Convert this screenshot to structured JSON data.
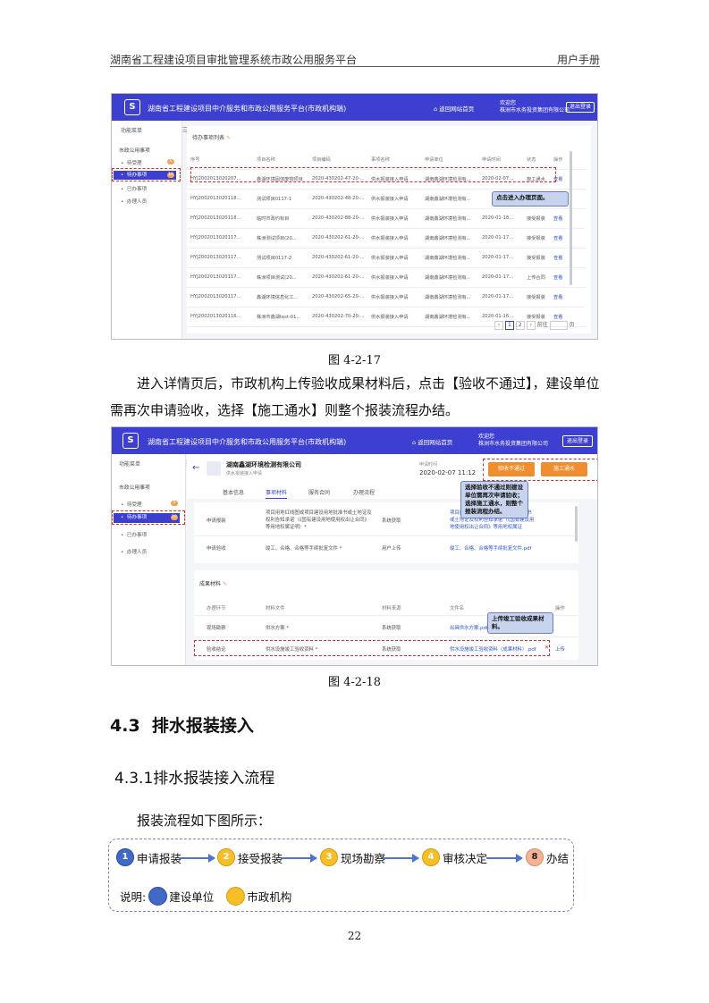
{
  "header": {
    "title": "湖南省工程建设项目审批管理系统市政公用服务平台",
    "doc_type": "用户手册"
  },
  "fig1": {
    "app_title": "湖南省工程建设项目中介服务和市政公用服务平台(市政机构端)",
    "home_link": "返回网站首页",
    "welcome_line1": "欢迎您",
    "welcome_line2": "株洲市水务投资集团有限公司",
    "logout": "退出登录",
    "menu_title": "功能菜单",
    "menu_group": "市政公用事项",
    "menu_items": [
      {
        "label": "待受理",
        "count": "5"
      },
      {
        "label": "待办事项",
        "count": "10"
      },
      {
        "label": "已办事项",
        "count": ""
      },
      {
        "label": "办理人员",
        "count": ""
      }
    ],
    "list_title": "待办事项列表",
    "columns": [
      "序号",
      "项目名称",
      "项目编码",
      "事项名称",
      "申请单位",
      "申请时间",
      "状态",
      "操作"
    ],
    "rows": [
      [
        "HYJ2002013020207...",
        "鑫湖环境固体废物项目",
        "2020-430202-47-20-...",
        "供水报装接入申请",
        "湖南鑫湖环境检测有...",
        "2020-02-07...",
        "施工通水",
        "查看"
      ],
      [
        "HYJ2002013020118...",
        "测试项目0117-1",
        "2020-430202-48-20-...",
        "供水报装接入申请",
        "湖南鑫湖环境检测有...",
        "",
        "",
        ""
      ],
      [
        "HYJ2002013020118...",
        "临时市政约标目",
        "2020-430202-88-20-...",
        "供水报装接入申请",
        "湖南鑫湖环境检测有...",
        "2020-01-18...",
        "接受报装",
        "查看"
      ],
      [
        "HYJ2002013020117...",
        "株洲测试项目(20...",
        "2020-430202-61-20-...",
        "供水报装接入申请",
        "湖南鑫湖环境检测有...",
        "2020-01-17...",
        "接受报装",
        "查看"
      ],
      [
        "HYJ2002013020117...",
        "测试项目0117-2",
        "2020-430202-61-20-...",
        "供水报装接入申请",
        "湖南鑫湖环境检测有...",
        "2020-01-17...",
        "接受报装",
        "查看"
      ],
      [
        "HYJ2002013020117...",
        "株洲项目测试(20...",
        "2020-430202-61-20-...",
        "供水报装接入申请",
        "湖南鑫湖环境检测有...",
        "2020-01-17...",
        "上传合同",
        "查看"
      ],
      [
        "HYJ2002013020117...",
        "鑫湖环境信息化工...",
        "2020-430202-65-20-...",
        "供水报装接入申请",
        "湖南鑫湖环境检测有...",
        "2020-01-17...",
        "接受报装",
        "查看"
      ],
      [
        "HYJ2002013020116...",
        "株洲市鑫湖test-01...",
        "2020-430202-70-20-...",
        "供水报装接入申请",
        "湖南鑫湖环境检测有...",
        "2020-01-16...",
        "接受报装",
        "查看"
      ]
    ],
    "pagination": {
      "p1": "1",
      "p2": "2",
      "goto": "前往",
      "unit": "页"
    },
    "callout": "点击进入办理页面。"
  },
  "caption1": "图 4-2-17",
  "para1": "进入详情页后，市政机构上传验收成果材料后，点击【验收不通过】，建设单位需再次申请验收，选择【施工通水】则整个报装流程办结。",
  "fig2": {
    "app_title": "湖南省工程建设项目中介服务和市政公用服务平台(市政机构端)",
    "home_link": "返回网站首页",
    "welcome_line1": "欢迎您",
    "welcome_line2": "株洲市水务投资集团有限公司",
    "logout": "退出登录",
    "menu_title": "功能菜单",
    "menu_group": "市政公用事项",
    "menu_items": [
      {
        "label": "待受理",
        "count": "5"
      },
      {
        "label": "待办事项",
        "count": "10"
      },
      {
        "label": "已办事项",
        "count": ""
      },
      {
        "label": "办理人员",
        "count": ""
      }
    ],
    "company": "湖南鑫湖环境检测有限公司",
    "company_sub": "供水报装接入申请",
    "date_label": "申请时间",
    "date": "2020-02-07 11:12",
    "btn_fail": "验收不通过",
    "btn_pass": "施工通水",
    "tabs": [
      "基本信息",
      "事项材料",
      "服务合同",
      "办理流程"
    ],
    "upper_rows": [
      {
        "stage": "申请报装",
        "name": "项目用地红线图或项目建设用地批准书或土地证及权利告知承诺（《国有建设用地使用权出让合同》等用地权属证明）*",
        "source": "系统获取",
        "file": "项目用地红线图或项目建设用地批准书或土地证及权利告知承诺（《国有建设用地使用权出让合同》等用地权属证明).pdf"
      },
      {
        "stage": "申请验收",
        "name": "竣工、合格、合格等手续批复文件 *",
        "source": "用户上传",
        "file": "竣工、合格、合格等手续批复文件.pdf"
      }
    ],
    "section2_title": "成果材料",
    "cols2": [
      "办理环节",
      "材料文件",
      "材料来源",
      "文件名",
      "操作"
    ],
    "rows2": [
      {
        "stage": "现场勘察",
        "name": "供水方案 *",
        "source": "系统获取",
        "file": "出具供水方案.pdf",
        "op": ""
      },
      {
        "stage": "验收结论",
        "name": "供水设施竣工验收资料 *",
        "source": "系统获取",
        "file": "供水设施竣工验收资料（成果材料）.pdf",
        "op": "上传"
      }
    ],
    "callout1": "选择验收不通过则建设单位需再次申请验收；选择施工通水，则整个报装流程办结。",
    "callout2": "上传竣工验收成果材料。"
  },
  "caption2": "图 4-2-18",
  "h_section": "4.3  排水报装接入",
  "h_sub": "4.3.1排水报装接入流程",
  "para2": "报装流程如下图所示：",
  "flow": {
    "steps": [
      {
        "num": "1",
        "label": "申请报装",
        "color": "blue"
      },
      {
        "num": "2",
        "label": "接受报装",
        "color": "yellow"
      },
      {
        "num": "3",
        "label": "现场勘察",
        "color": "yellow"
      },
      {
        "num": "4",
        "label": "审核决定",
        "color": "yellow"
      },
      {
        "num": "8",
        "label": "办结",
        "color": "pink"
      }
    ],
    "legend_prefix": "说明:",
    "legend_blue": "建设单位",
    "legend_yellow": "市政机构",
    "colors": {
      "blue": "#4169c8",
      "yellow": "#f6be29",
      "pink": "#f4b395",
      "arrow": "#4d74d3"
    }
  },
  "page_number": "22"
}
